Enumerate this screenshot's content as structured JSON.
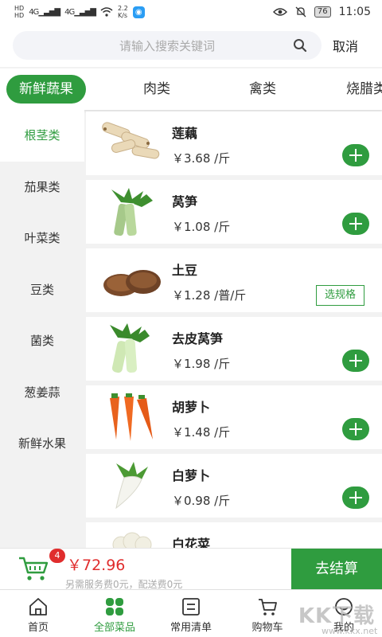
{
  "status_bar": {
    "sim_labels": [
      "HD",
      "HD"
    ],
    "network_1": "4G",
    "network_2": "4G",
    "speed": "2.2\nK/s",
    "battery": "76",
    "time": "11:05",
    "icons": [
      "eye-icon",
      "mute-bell-icon",
      "wifi-icon",
      "signal-icon",
      "battery-icon"
    ]
  },
  "search": {
    "placeholder": "请输入搜索关键词",
    "cancel_label": "取消"
  },
  "categories": [
    "新鲜蔬果",
    "肉类",
    "禽类",
    "烧腊类"
  ],
  "sidebar": {
    "items": [
      "根茎类",
      "茄果类",
      "叶菜类",
      "豆类",
      "菌类",
      "葱姜蒜",
      "新鲜水果"
    ]
  },
  "products": [
    {
      "name": "莲藕",
      "price": "￥3.68 /斤",
      "action": "add",
      "image": "lotus-root"
    },
    {
      "name": "莴笋",
      "price": "￥1.08 /斤",
      "action": "add",
      "image": "lettuce-stem"
    },
    {
      "name": "土豆",
      "price": "￥1.28 /普/斤",
      "action": "spec",
      "spec_label": "选规格",
      "image": "potato"
    },
    {
      "name": "去皮莴笋",
      "price": "￥1.98 /斤",
      "action": "add",
      "image": "peeled-lettuce-stem"
    },
    {
      "name": "胡萝卜",
      "price": "￥1.48 /斤",
      "action": "add",
      "image": "carrot"
    },
    {
      "name": "白萝卜",
      "price": "￥0.98 /斤",
      "action": "add",
      "image": "white-radish"
    },
    {
      "name": "白花菜",
      "price": "",
      "action": "add",
      "image": "cauliflower"
    }
  ],
  "cart": {
    "badge_count": "4",
    "total": "￥72.96",
    "note": "另需服务费0元，配送费0元",
    "checkout_label": "去结算"
  },
  "bottom_nav": [
    {
      "label": "首页",
      "icon": "home-icon"
    },
    {
      "label": "全部菜品",
      "icon": "grid-icon"
    },
    {
      "label": "常用清单",
      "icon": "list-icon"
    },
    {
      "label": "购物车",
      "icon": "cart-icon"
    },
    {
      "label": "我的",
      "icon": "user-icon"
    }
  ],
  "watermark": {
    "text": "KK下载",
    "url": "www.kkx.net"
  },
  "colors": {
    "accent": "#2f9c3f",
    "price_red": "#e02d2d",
    "background": "#f2f2f2"
  }
}
